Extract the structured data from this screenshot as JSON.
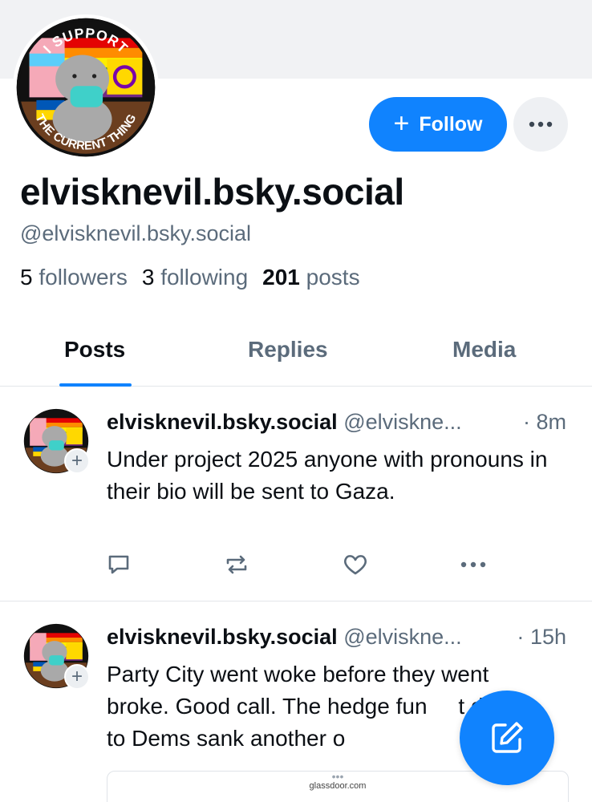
{
  "profile": {
    "display_name": "elvisknevil.bsky.social",
    "handle": "@elvisknevil.bsky.social",
    "followers_count": "5",
    "followers_label": "followers",
    "following_count": "3",
    "following_label": "following",
    "posts_count": "201",
    "posts_label": "posts",
    "follow_label": "Follow",
    "avatar_text_top": "I SUPPORT",
    "avatar_text_bottom": "THE CURRENT THING"
  },
  "tabs": [
    {
      "label": "Posts",
      "active": true
    },
    {
      "label": "Replies",
      "active": false
    },
    {
      "label": "Media",
      "active": false
    }
  ],
  "posts": [
    {
      "author": "elvisknevil.bsky.social",
      "handle": "@elviskne...",
      "separator": "·",
      "time": "8m",
      "text": "Under project 2025 anyone with pronouns in their bio will be sent to Gaza."
    },
    {
      "author": "elvisknevil.bsky.social",
      "handle": "@elviskne...",
      "separator": "·",
      "time": "15h",
      "text": "Party City went woke before they went broke. Good call. The hedge fun     t donate to Dems sank another o",
      "link_domain": "glassdoor.com"
    }
  ],
  "colors": {
    "accent": "#1083fe",
    "muted_text": "#5b6b7b",
    "banner": "#f1f2f4"
  },
  "icons": [
    "plus-icon",
    "ellipsis-icon",
    "reply-icon",
    "repost-icon",
    "like-icon",
    "compose-icon"
  ]
}
